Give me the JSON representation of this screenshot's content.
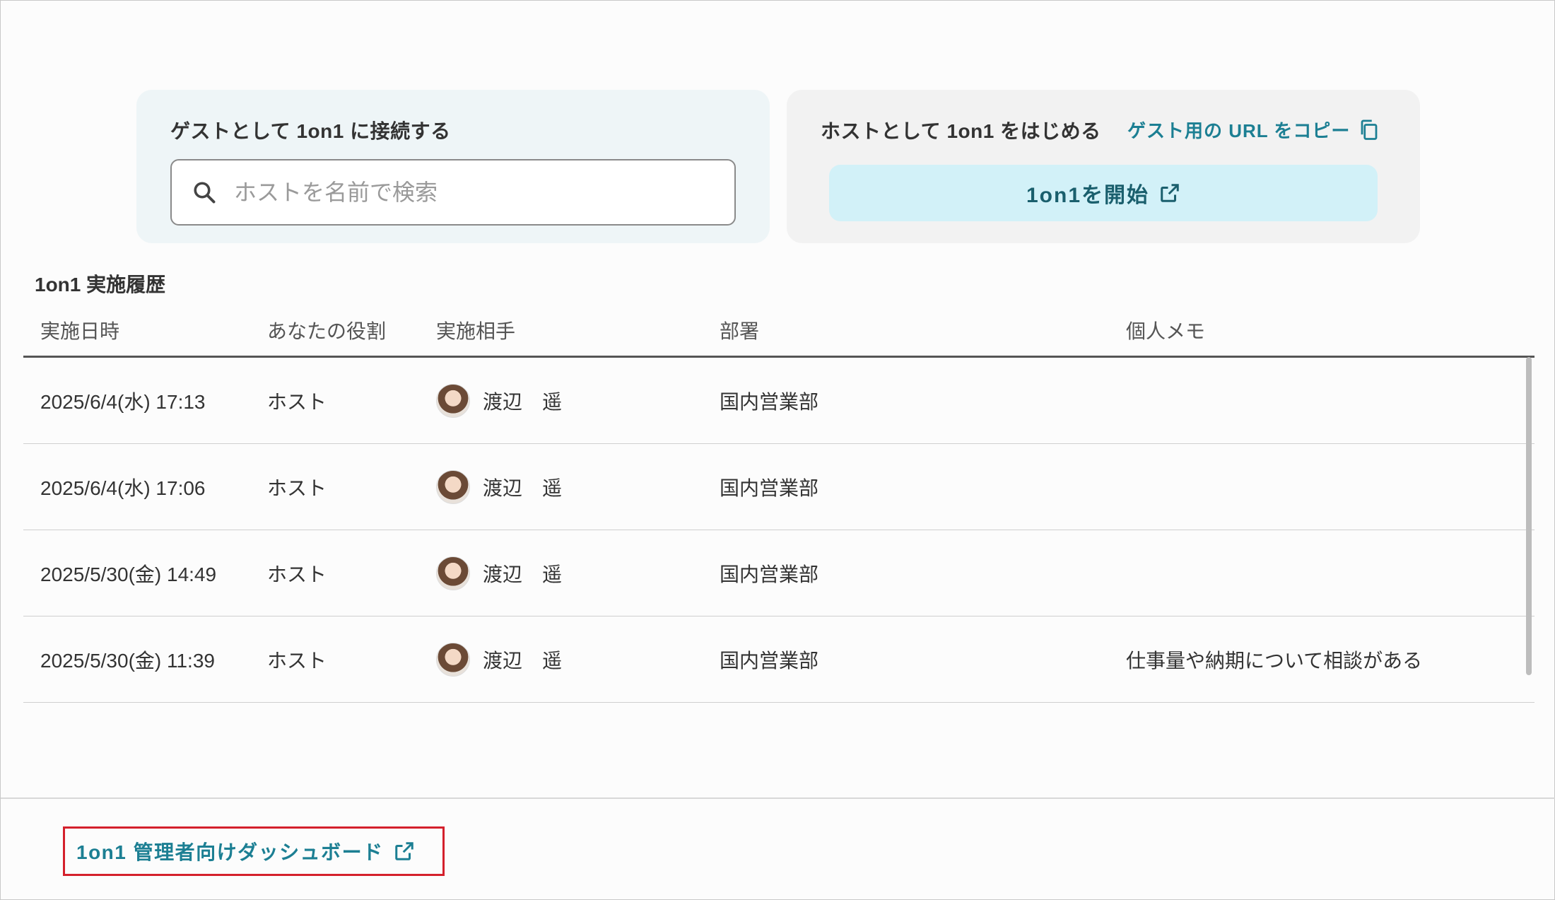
{
  "guest_card": {
    "title": "ゲストとして 1on1 に接続する",
    "search_placeholder": "ホストを名前で検索",
    "search_value": ""
  },
  "host_card": {
    "title": "ホストとして 1on1 をはじめる",
    "copy_url_label": "ゲスト用の URL をコピー",
    "start_button_label": "1on1を開始"
  },
  "history": {
    "title": "1on1 実施履歴",
    "columns": [
      "実施日時",
      "あなたの役割",
      "実施相手",
      "部署",
      "個人メモ"
    ],
    "rows": [
      {
        "date": "2025/6/4(水) 17:13",
        "role": "ホスト",
        "partner": "渡辺　遥",
        "dept": "国内営業部",
        "memo": ""
      },
      {
        "date": "2025/6/4(水) 17:06",
        "role": "ホスト",
        "partner": "渡辺　遥",
        "dept": "国内営業部",
        "memo": ""
      },
      {
        "date": "2025/5/30(金) 14:49",
        "role": "ホスト",
        "partner": "渡辺　遥",
        "dept": "国内営業部",
        "memo": ""
      },
      {
        "date": "2025/5/30(金) 11:39",
        "role": "ホスト",
        "partner": "渡辺　遥",
        "dept": "国内営業部",
        "memo": "仕事量や納期について相談がある"
      }
    ]
  },
  "footer": {
    "dashboard_link_label": "1on1 管理者向けダッシュボード"
  },
  "colors": {
    "accent": "#1c7f93",
    "start_button_bg": "#d2f1f8",
    "highlight_border": "#d4202c"
  },
  "icons": {
    "search": "search-icon",
    "copy": "copy-icon",
    "external": "external-link-icon"
  }
}
